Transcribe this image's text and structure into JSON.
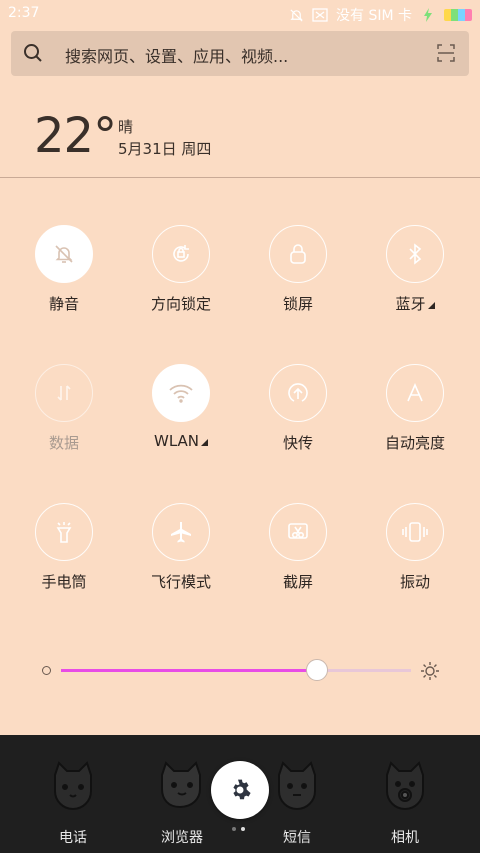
{
  "status_bar": {
    "time": "2:37",
    "carrier": "没有 SIM 卡",
    "icons": [
      "alarm-off-icon",
      "mail-icon",
      "charging-icon",
      "battery-icon"
    ]
  },
  "search": {
    "placeholder": "搜索网页、设置、应用、视频...",
    "icon": "search-icon",
    "scan_icon": "scan-icon"
  },
  "weather": {
    "temperature": "22°",
    "condition": "晴",
    "date": "5月31日 周四"
  },
  "tiles": [
    {
      "label": "静音",
      "icon": "silent-icon",
      "state": "active"
    },
    {
      "label": "方向锁定",
      "icon": "rotation-lock-icon",
      "state": "off"
    },
    {
      "label": "锁屏",
      "icon": "lock-icon",
      "state": "off"
    },
    {
      "label": "蓝牙",
      "icon": "bluetooth-icon",
      "state": "off",
      "has_menu": true
    },
    {
      "label": "数据",
      "icon": "data-icon",
      "state": "disabled"
    },
    {
      "label": "WLAN",
      "icon": "wifi-icon",
      "state": "active",
      "has_menu": true
    },
    {
      "label": "快传",
      "icon": "quick-transfer-icon",
      "state": "off"
    },
    {
      "label": "自动亮度",
      "icon": "auto-brightness-icon",
      "state": "off"
    },
    {
      "label": "手电筒",
      "icon": "flashlight-icon",
      "state": "off"
    },
    {
      "label": "飞行模式",
      "icon": "airplane-icon",
      "state": "off"
    },
    {
      "label": "截屏",
      "icon": "screenshot-icon",
      "state": "off"
    },
    {
      "label": "振动",
      "icon": "vibrate-icon",
      "state": "off"
    }
  ],
  "brightness": {
    "level": 0.73,
    "fill_color": "#e84ce6"
  },
  "dock": {
    "apps": [
      {
        "label": "电话",
        "icon": "phone-cat-icon"
      },
      {
        "label": "浏览器",
        "icon": "browser-cat-icon"
      },
      {
        "label": "短信",
        "icon": "messages-cat-icon"
      },
      {
        "label": "相机",
        "icon": "camera-cat-icon"
      }
    ],
    "settings_icon": "gear-icon",
    "page_count": 2,
    "current_page": 1
  },
  "colors": {
    "background": "#fbdcc4",
    "dock": "#1f1f1f",
    "accent": "#e84ce6"
  }
}
